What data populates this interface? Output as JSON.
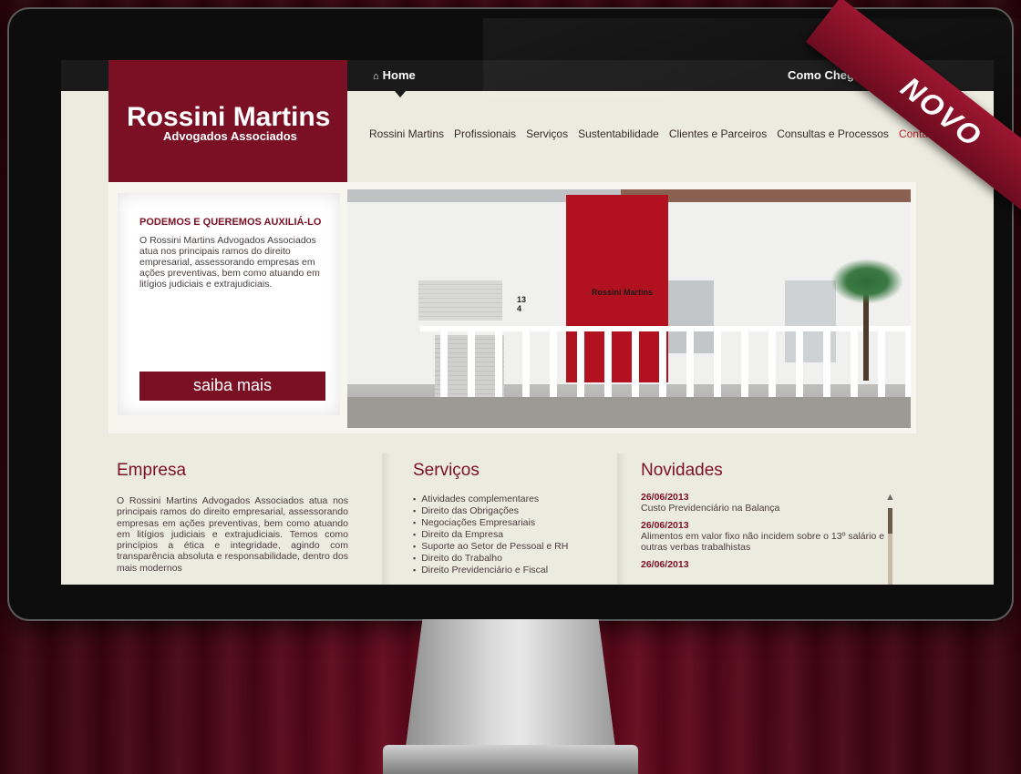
{
  "header": {
    "logo_name": "Rossini Martins",
    "logo_sub": "Advogados  Associados",
    "home_label": "Home",
    "como_chegar": "Como Chegar"
  },
  "nav": {
    "items": [
      {
        "label": "Rossini Martins"
      },
      {
        "label": "Profissionais"
      },
      {
        "label": "Serviços"
      },
      {
        "label": "Sustentabilidade"
      },
      {
        "label": "Clientes e Parceiros"
      },
      {
        "label": "Consultas e Processos"
      },
      {
        "label": "Contato"
      }
    ]
  },
  "hero": {
    "title": "PODEMOS E QUEREMOS AUXILIÁ-LO",
    "body": "O Rossini Martins Advogados Associados atua nos principais ramos do direito empresarial, assessorando empresas em ações preventivas, bem como atuando em litígios judiciais e extrajudiciais.",
    "button_label": "saiba mais",
    "building_sign": "Rossini Martins",
    "building_number": "134"
  },
  "empresa": {
    "title": "Empresa",
    "body": "O Rossini Martins Advogados Associados atua nos principais ramos do direito empresarial, assessorando empresas em ações preventivas, bem como atuando em litígios judiciais e extrajudiciais. Temos como princípios a ética e integridade, agindo com transparência absoluta e responsabilidade, dentro dos mais modernos"
  },
  "servicos": {
    "title": "Serviços",
    "items": [
      "Atividades complementares",
      "Direito das Obrigações",
      "Negociações Empresariais",
      "Direito da Empresa",
      "Suporte ao Setor de Pessoal e RH",
      "Direito do Trabalho",
      "Direito Previdenciário e Fiscal"
    ]
  },
  "novidades": {
    "title": "Novidades",
    "items": [
      {
        "date": "26/06/2013",
        "text": "Custo Previdenciário na Balança"
      },
      {
        "date": "26/06/2013",
        "text": "Alimentos em valor fixo não incidem sobre o 13º salário e outras verbas trabalhistas"
      },
      {
        "date": "26/06/2013",
        "text": ""
      }
    ]
  },
  "ribbon": {
    "label": "NOVO"
  },
  "colors": {
    "brand": "#7b1025",
    "active_nav": "#c8232c",
    "screen_bg": "#ebebdf"
  }
}
